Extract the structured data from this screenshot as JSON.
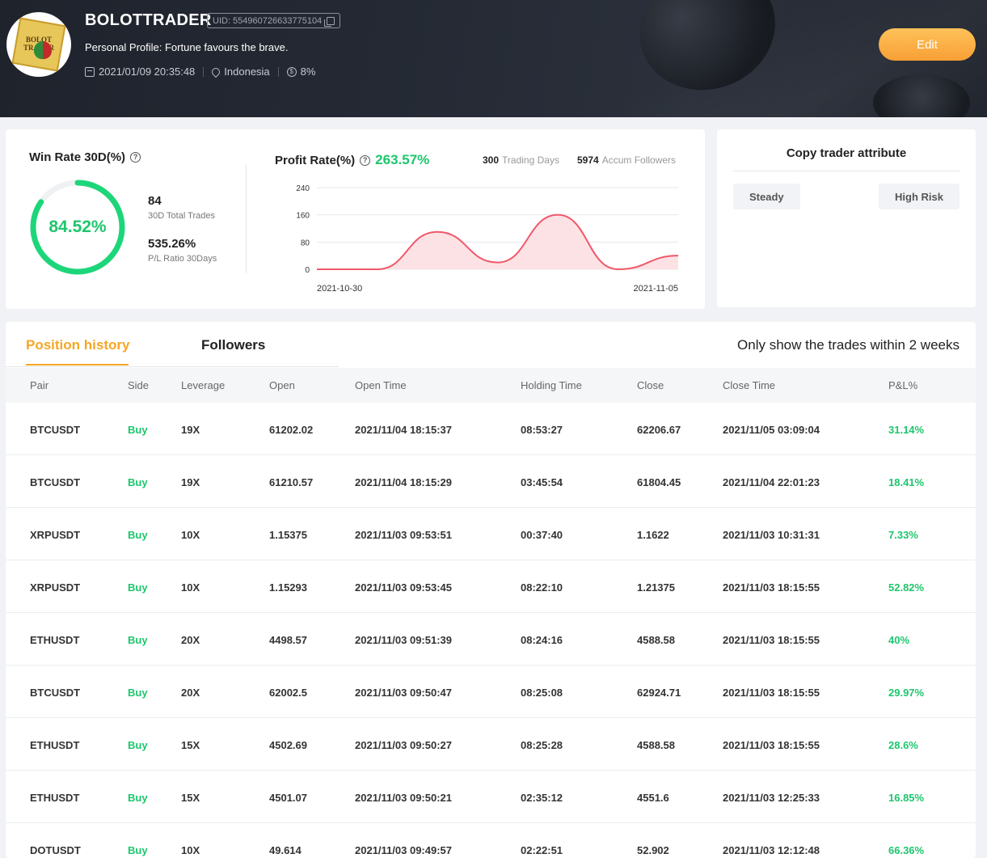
{
  "profile": {
    "name": "BOLOTTRADER",
    "uid": "UID: 554960726633775104",
    "bio": "Personal Profile: Fortune favours the brave.",
    "joined": "2021/01/09 20:35:48",
    "country": "Indonesia",
    "fee": "8%",
    "avatar_text": "BOLOTTRADER",
    "edit_label": "Edit"
  },
  "stats": {
    "win_rate_title": "Win Rate 30D(%)",
    "win_rate_value": "84.52%",
    "win_rate_fraction": 0.8452,
    "total_trades_value": "84",
    "total_trades_label": "30D Total Trades",
    "pl_ratio_value": "535.26%",
    "pl_ratio_label": "P/L Ratio 30Days",
    "profit_rate_title": "Profit Rate(%)",
    "profit_rate_value": "263.57%",
    "trading_days_value": "300",
    "trading_days_label": "Trading Days",
    "followers_value": "5974",
    "followers_label": "Accum Followers"
  },
  "chart_data": {
    "type": "area",
    "x": [
      "2021-10-30",
      "2021-10-31",
      "2021-11-01",
      "2021-11-02",
      "2021-11-03",
      "2021-11-04",
      "2021-11-05"
    ],
    "values": [
      0,
      0,
      110,
      20,
      160,
      0,
      40
    ],
    "x_tick_labels": [
      "2021-10-30",
      "2021-11-05"
    ],
    "y_ticks": [
      0,
      80,
      160,
      240
    ],
    "ylim": [
      0,
      240
    ],
    "grid": true,
    "color": "#f0596a",
    "fill_color": "#fde2e5"
  },
  "attributes": {
    "title": "Copy trader attribute",
    "tags": [
      "Steady",
      "High Risk"
    ]
  },
  "tabs": {
    "position_history": "Position history",
    "followers": "Followers",
    "note": "Only show the trades within 2 weeks"
  },
  "table": {
    "columns": [
      "Pair",
      "Side",
      "Leverage",
      "Open",
      "Open Time",
      "Holding Time",
      "Close",
      "Close Time",
      "P&L%"
    ],
    "rows": [
      [
        "BTCUSDT",
        "Buy",
        "19X",
        "61202.02",
        "2021/11/04 18:15:37",
        "08:53:27",
        "62206.67",
        "2021/11/05 03:09:04",
        "31.14%"
      ],
      [
        "BTCUSDT",
        "Buy",
        "19X",
        "61210.57",
        "2021/11/04 18:15:29",
        "03:45:54",
        "61804.45",
        "2021/11/04 22:01:23",
        "18.41%"
      ],
      [
        "XRPUSDT",
        "Buy",
        "10X",
        "1.15375",
        "2021/11/03 09:53:51",
        "00:37:40",
        "1.1622",
        "2021/11/03 10:31:31",
        "7.33%"
      ],
      [
        "XRPUSDT",
        "Buy",
        "10X",
        "1.15293",
        "2021/11/03 09:53:45",
        "08:22:10",
        "1.21375",
        "2021/11/03 18:15:55",
        "52.82%"
      ],
      [
        "ETHUSDT",
        "Buy",
        "20X",
        "4498.57",
        "2021/11/03 09:51:39",
        "08:24:16",
        "4588.58",
        "2021/11/03 18:15:55",
        "40%"
      ],
      [
        "BTCUSDT",
        "Buy",
        "20X",
        "62002.5",
        "2021/11/03 09:50:47",
        "08:25:08",
        "62924.71",
        "2021/11/03 18:15:55",
        "29.97%"
      ],
      [
        "ETHUSDT",
        "Buy",
        "15X",
        "4502.69",
        "2021/11/03 09:50:27",
        "08:25:28",
        "4588.58",
        "2021/11/03 18:15:55",
        "28.6%"
      ],
      [
        "ETHUSDT",
        "Buy",
        "15X",
        "4501.07",
        "2021/11/03 09:50:21",
        "02:35:12",
        "4551.6",
        "2021/11/03 12:25:33",
        "16.85%"
      ],
      [
        "DOTUSDT",
        "Buy",
        "10X",
        "49.614",
        "2021/11/03 09:49:57",
        "02:22:51",
        "52.902",
        "2021/11/03 12:12:48",
        "66.36%"
      ]
    ]
  }
}
